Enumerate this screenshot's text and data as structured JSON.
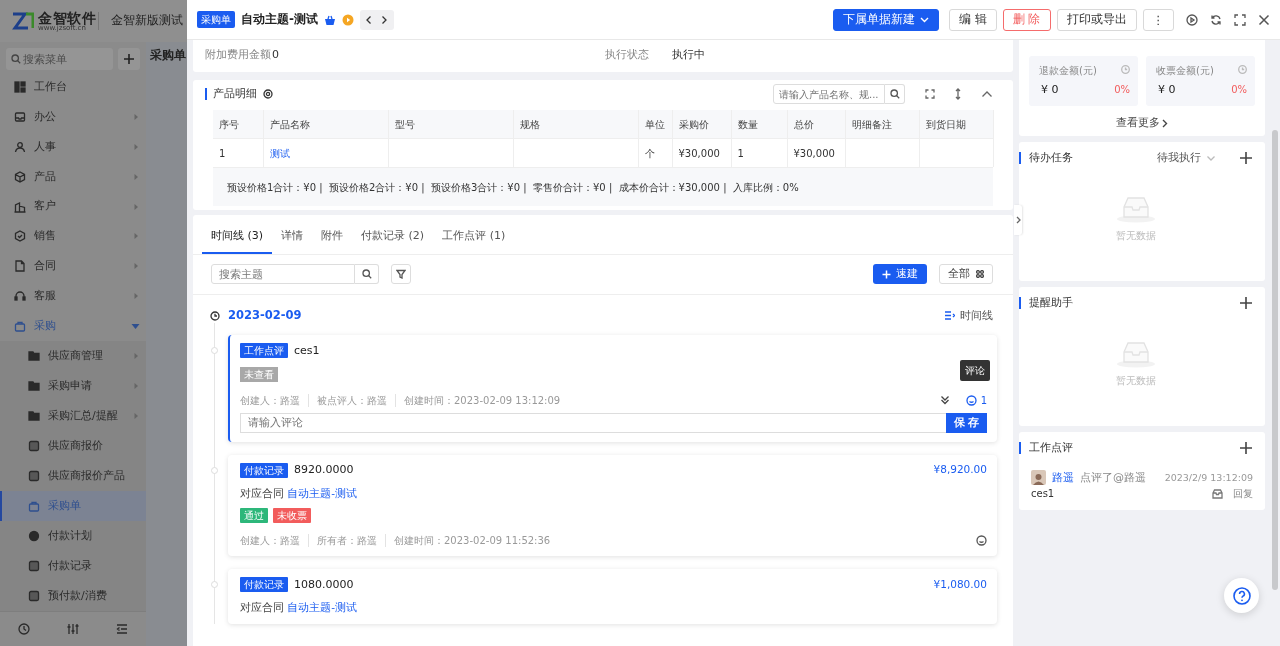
{
  "app": {
    "logo": {
      "name": "金智软件",
      "url": "www.jzsoft.cn"
    },
    "title": "金智新版测试",
    "search_placeholder": "搜索菜单",
    "page_tab": "采购单",
    "menu": [
      {
        "label": "工作台",
        "selected": false
      },
      {
        "label": "办公",
        "selected": false,
        "expanded": false
      },
      {
        "label": "人事",
        "selected": false,
        "expanded": false
      },
      {
        "label": "产品",
        "selected": false,
        "expanded": false
      },
      {
        "label": "客户",
        "selected": false,
        "expanded": false
      },
      {
        "label": "销售",
        "selected": false,
        "expanded": false
      },
      {
        "label": "合同",
        "selected": false,
        "expanded": false
      },
      {
        "label": "客服",
        "selected": false,
        "expanded": false
      },
      {
        "label": "采购",
        "selected": true,
        "expanded": true,
        "children": [
          {
            "label": "供应商管理",
            "selected": false,
            "expanded": false
          },
          {
            "label": "采购申请",
            "selected": false,
            "expanded": false
          },
          {
            "label": "采购汇总/提醒",
            "selected": false,
            "expanded": false
          },
          {
            "label": "供应商报价",
            "selected": false
          },
          {
            "label": "供应商报价产品",
            "selected": false
          },
          {
            "label": "采购单",
            "selected": true
          },
          {
            "label": "付款计划",
            "selected": false
          },
          {
            "label": "付款记录",
            "selected": false
          },
          {
            "label": "预付款/消费",
            "selected": false
          }
        ]
      }
    ]
  },
  "drawer": {
    "badge": "采购单",
    "title": "自动主题-测试",
    "buttons": [
      {
        "label": "下属单据新建",
        "kind": "primary"
      },
      {
        "label": "编 辑",
        "kind": "default"
      },
      {
        "label": "删 除",
        "kind": "danger"
      },
      {
        "label": "打印或导出",
        "kind": "default"
      },
      {
        "label": "⋮",
        "kind": "default"
      }
    ]
  },
  "info": [
    {
      "label": "附加费用金额",
      "value": "0"
    },
    {
      "label": "执行状态",
      "value": "执行中"
    }
  ],
  "products": {
    "title": "产品明细",
    "search_placeholder": "请输入产品名称、规...",
    "columns": [
      "序号",
      "产品名称",
      "型号",
      "规格",
      "单位",
      "采购价",
      "数量",
      "总价",
      "明细备注",
      "到货日期"
    ],
    "rows": [
      {
        "no": "1",
        "name": "测试",
        "unit": "个",
        "price": "¥30,000",
        "qty": "1",
        "total": "¥30,000"
      }
    ],
    "summary": "预设价格1合计：¥0 |  预设价格2合计：¥0 |  预设价格3合计：¥0 |  零售价合计：¥0 |  成本价合计：¥30,000 |  入库比例：0%"
  },
  "timeline": {
    "tabs": [
      {
        "label": "时间线 (3)",
        "selected": true
      },
      {
        "label": "详情",
        "selected": false
      },
      {
        "label": "附件",
        "selected": false
      },
      {
        "label": "付款记录 (2)",
        "selected": false
      },
      {
        "label": "工作点评 (1)",
        "selected": false
      }
    ],
    "search_placeholder": "搜索主题",
    "quick_button": "速建",
    "all_button": "全部",
    "date": "2023-02-09",
    "view_toggle": "时间线",
    "entries": [
      {
        "kind": "comment",
        "selected": true,
        "tag": "工作点评",
        "title": "ces1",
        "status": "未查看",
        "meta": [
          "创建人：路遥",
          "被点评人：路遥",
          "创建时间：2023-02-09 13:12:09"
        ],
        "comment_count": "1",
        "tooltip": "评论",
        "input_placeholder": "请输入评论",
        "save": "保 存"
      },
      {
        "kind": "payment",
        "selected": false,
        "tag": "付款记录",
        "title": "8920.0000",
        "amount": "¥8,920.00",
        "contract_label": "对应合同",
        "contract": "自动主题-测试",
        "tags": [
          {
            "label": "通过",
            "color": "#2db77a"
          },
          {
            "label": "未收票",
            "color": "#f25c5c"
          }
        ],
        "meta": [
          "创建人：路遥",
          "所有者：路遥",
          "创建时间：2023-02-09 11:52:36"
        ]
      },
      {
        "kind": "payment",
        "selected": false,
        "tag": "付款记录",
        "title": "1080.0000",
        "amount": "¥1,080.00",
        "contract_label": "对应合同",
        "contract": "自动主题-测试"
      }
    ]
  },
  "side": {
    "stats": [
      {
        "label": "退款金额(元)",
        "value": "¥ 0",
        "percent": "0%"
      },
      {
        "label": "收票金额(元)",
        "value": "¥ 0",
        "percent": "0%"
      }
    ],
    "more": "查看更多",
    "panels": [
      {
        "title": "待办任务",
        "filter": "待我执行",
        "empty": "暂无数据"
      },
      {
        "title": "提醒助手",
        "empty": "暂无数据"
      },
      {
        "title": "工作点评",
        "reviews": [
          {
            "author": "路遥",
            "action": "点评了@路遥",
            "time": "2023/2/9 13:12:09",
            "text": "ces1",
            "reply": "回复"
          }
        ]
      }
    ]
  }
}
